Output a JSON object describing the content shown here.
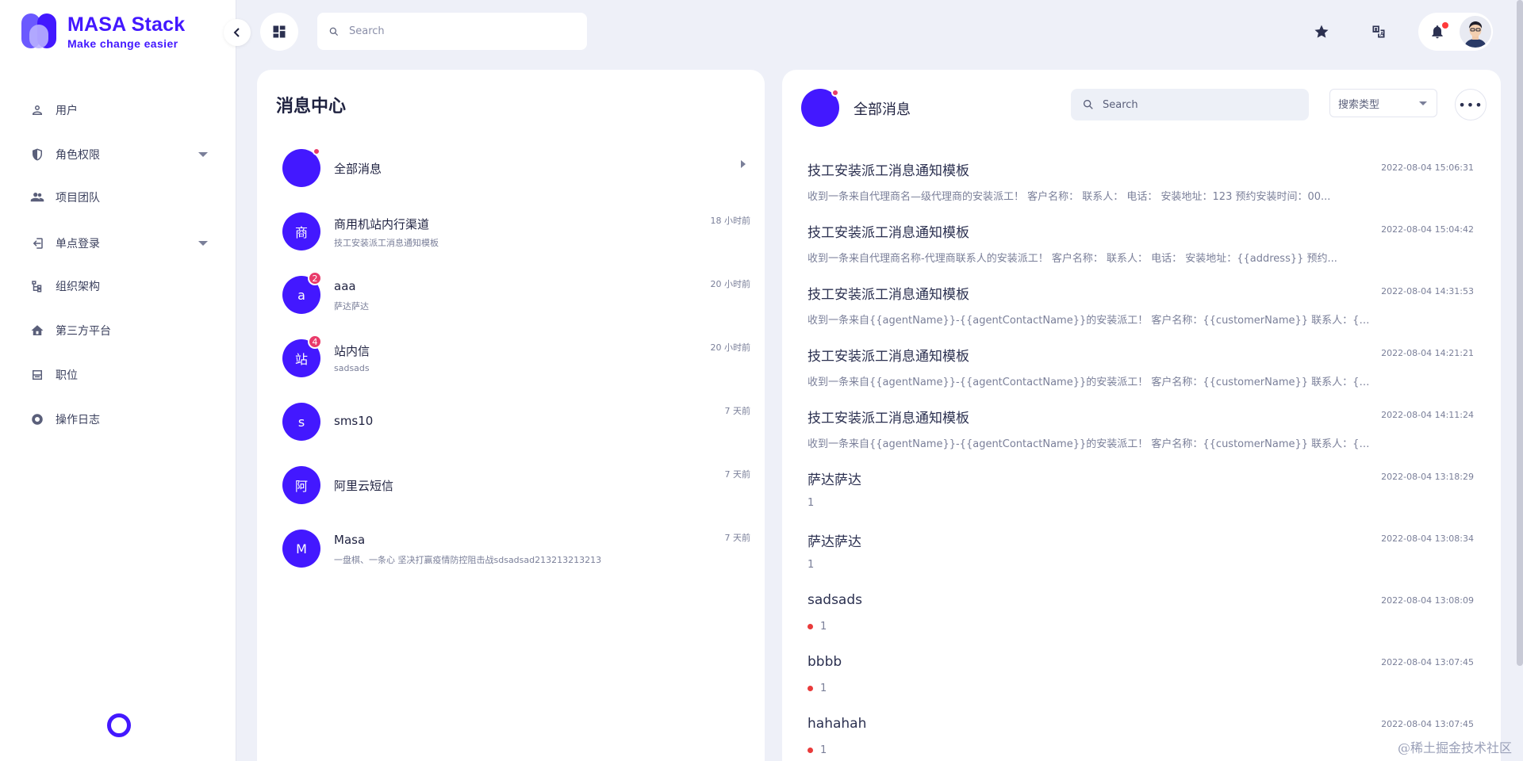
{
  "brand": {
    "title": "MASA Stack",
    "subtitle": "Make change easier",
    "accent": "#4318ff"
  },
  "topbar": {
    "search_placeholder": "Search"
  },
  "sidebar": {
    "items": [
      {
        "label": "用户",
        "icon": "user-icon",
        "expandable": false
      },
      {
        "label": "角色权限",
        "icon": "shield-icon",
        "expandable": true
      },
      {
        "label": "项目团队",
        "icon": "team-icon",
        "expandable": false
      },
      {
        "label": "单点登录",
        "icon": "login-icon",
        "expandable": true
      },
      {
        "label": "组织架构",
        "icon": "org-chart-icon",
        "expandable": false
      },
      {
        "label": "第三方平台",
        "icon": "house-icon",
        "expandable": false
      },
      {
        "label": "职位",
        "icon": "card-icon",
        "expandable": false
      },
      {
        "label": "操作日志",
        "icon": "record-icon",
        "expandable": false
      }
    ]
  },
  "message_center": {
    "title": "消息中心",
    "conversations": [
      {
        "avatar": "",
        "name": "全部消息",
        "preview": "",
        "time": "",
        "badge": "",
        "dot": true
      },
      {
        "avatar": "商",
        "name": "商用机站内行渠道",
        "preview": "技工安装派工消息通知模板",
        "time": "18 小时前",
        "badge": ""
      },
      {
        "avatar": "a",
        "name": "aaa",
        "preview": "萨达萨达",
        "time": "20 小时前",
        "badge": "2"
      },
      {
        "avatar": "站",
        "name": "站内信",
        "preview": "sadsads",
        "time": "20 小时前",
        "badge": "4"
      },
      {
        "avatar": "s",
        "name": "sms10",
        "preview": "",
        "time": "7 天前",
        "badge": ""
      },
      {
        "avatar": "阿",
        "name": "阿里云短信",
        "preview": "",
        "time": "7 天前",
        "badge": ""
      },
      {
        "avatar": "M",
        "name": "Masa",
        "preview": "一盘棋、一条心 坚决打赢疫情防控阻击战sdsadsad213213213213",
        "time": "7 天前",
        "badge": ""
      }
    ]
  },
  "messages_panel": {
    "title": "全部消息",
    "search_placeholder": "Search",
    "type_select_label": "搜索类型",
    "more_label": "•••",
    "items": [
      {
        "title": "技工安装派工消息通知模板",
        "time": "2022-08-04 15:06:31",
        "body": "收到一条来自代理商名—级代理商的安装派工！ 客户名称： 联系人： 电话： 安装地址：123 预约安装时间：00...",
        "unread": false
      },
      {
        "title": "技工安装派工消息通知模板",
        "time": "2022-08-04 15:04:42",
        "body": "收到一条来自代理商名称-代理商联系人的安装派工！ 客户名称： 联系人： 电话： 安装地址：{{address}} 预约...",
        "unread": false
      },
      {
        "title": "技工安装派工消息通知模板",
        "time": "2022-08-04 14:31:53",
        "body": "收到一条来自{{agentName}}-{{agentContactName}}的安装派工！ 客户名称：{{customerName}} 联系人：{{cus...",
        "unread": false
      },
      {
        "title": "技工安装派工消息通知模板",
        "time": "2022-08-04 14:21:21",
        "body": "收到一条来自{{agentName}}-{{agentContactName}}的安装派工！ 客户名称：{{customerName}} 联系人：{{cus...",
        "unread": false
      },
      {
        "title": "技工安装派工消息通知模板",
        "time": "2022-08-04 14:11:24",
        "body": "收到一条来自{{agentName}}-{{agentContactName}}的安装派工！ 客户名称：{{customerName}} 联系人：{{cus...",
        "unread": false
      },
      {
        "title": "萨达萨达",
        "time": "2022-08-04 13:18:29",
        "body": "1",
        "unread": false
      },
      {
        "title": "萨达萨达",
        "time": "2022-08-04 13:08:34",
        "body": "1",
        "unread": false
      },
      {
        "title": "sadsads",
        "time": "2022-08-04 13:08:09",
        "body": "1",
        "unread": true
      },
      {
        "title": "bbbb",
        "time": "2022-08-04 13:07:45",
        "body": "1",
        "unread": true
      },
      {
        "title": "hahahah",
        "time": "2022-08-04 13:07:45",
        "body": "1",
        "unread": true
      }
    ]
  },
  "watermark": "@稀土掘金技术社区"
}
